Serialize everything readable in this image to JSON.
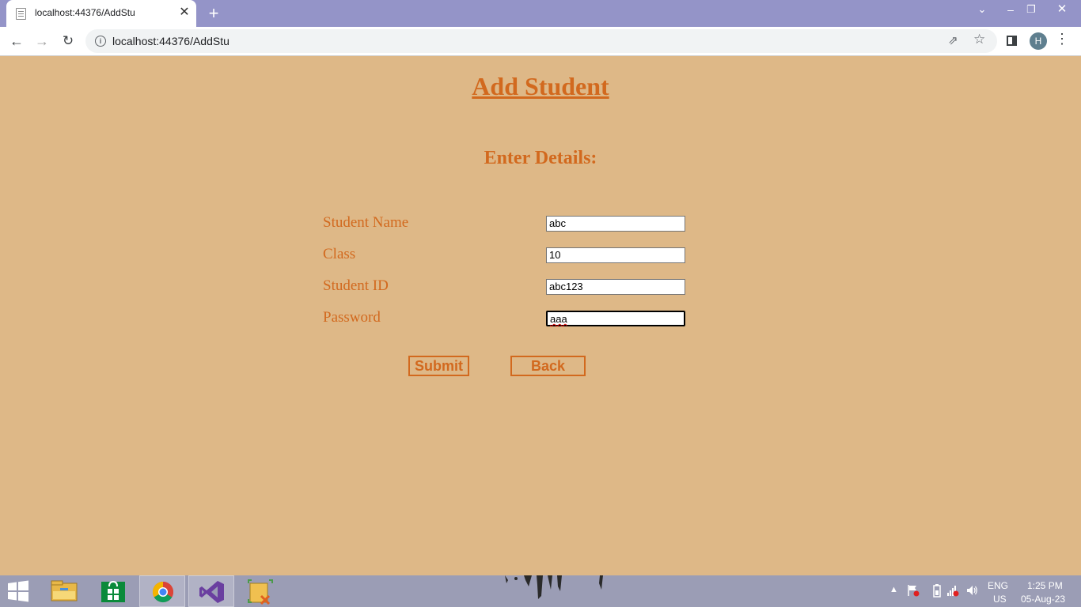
{
  "browser": {
    "tab_title": "localhost:44376/AddStu",
    "tab_close": "✕",
    "new_tab": "+",
    "url": "localhost:44376/AddStu",
    "profile_initial": "H",
    "window": {
      "tablist": "⌄",
      "minimize": "–",
      "restore": "❐",
      "close": "✕"
    },
    "nav": {
      "back": "←",
      "forward": "→",
      "reload": "↻",
      "share": "⇗",
      "star": "☆",
      "menu": "⋮",
      "info": "i"
    }
  },
  "page": {
    "title": "Add Student",
    "subtitle": "Enter Details:",
    "fields": [
      {
        "label": "Student Name",
        "value": "abc"
      },
      {
        "label": "Class",
        "value": "10"
      },
      {
        "label": "Student ID",
        "value": "abc123"
      },
      {
        "label": "Password",
        "value": "aaa"
      }
    ],
    "submit_label": "Submit",
    "back_label": "Back"
  },
  "colors": {
    "page_background": "#deb887",
    "accent_text": "#d2691e",
    "tabstrip": "#9494c8",
    "taskbar": "#9b9db5"
  },
  "taskbar": {
    "apps": [
      "start-button",
      "file-explorer-icon",
      "store-icon",
      "chrome-icon",
      "visual-studio-icon",
      "sql-server-icon"
    ],
    "language_line1": "ENG",
    "language_line2": "US",
    "time": "1:25 PM",
    "date": "05-Aug-23"
  }
}
